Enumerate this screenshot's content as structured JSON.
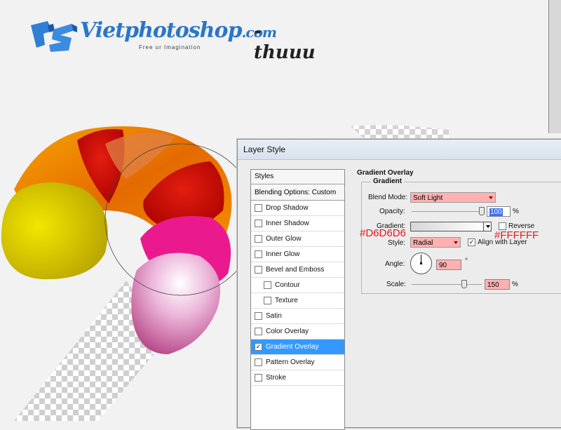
{
  "logo": {
    "brand": "Vietphotoshop",
    "tld": ".com",
    "signature": "-thuuu",
    "tagline": "Free ur Imagination"
  },
  "dialog": {
    "title": "Layer Style",
    "styles_header": "Styles",
    "blending_options": "Blending Options: Custom",
    "items": [
      {
        "label": "Drop Shadow",
        "checked": false
      },
      {
        "label": "Inner Shadow",
        "checked": false
      },
      {
        "label": "Outer Glow",
        "checked": false
      },
      {
        "label": "Inner Glow",
        "checked": false
      },
      {
        "label": "Bevel and Emboss",
        "checked": false
      },
      {
        "label": "Contour",
        "checked": false
      },
      {
        "label": "Texture",
        "checked": false
      },
      {
        "label": "Satin",
        "checked": false
      },
      {
        "label": "Color Overlay",
        "checked": false
      },
      {
        "label": "Gradient Overlay",
        "checked": true
      },
      {
        "label": "Pattern Overlay",
        "checked": false
      },
      {
        "label": "Stroke",
        "checked": false
      }
    ],
    "check_mark": "✓"
  },
  "gradient_overlay": {
    "section_title": "Gradient Overlay",
    "group_title": "Gradient",
    "blend_mode_label": "Blend Mode:",
    "blend_mode_value": "Soft Light",
    "opacity_label": "Opacity:",
    "opacity_value": "100",
    "opacity_level": 1.0,
    "percent": "%",
    "gradient_label": "Gradient:",
    "reverse_label": "Reverse",
    "reverse_checked": false,
    "style_label": "Style:",
    "style_value": "Radial",
    "align_label": "Align with Layer",
    "align_checked": true,
    "angle_label": "Angle:",
    "angle_value": "90",
    "degree": "°",
    "scale_label": "Scale:",
    "scale_value": "150",
    "scale_level": 0.75,
    "color_left": "#D6D6D6",
    "color_right": "#FFFFFF",
    "annot_left": "#D6D6D6",
    "annot_right": "#FFFFFF"
  }
}
